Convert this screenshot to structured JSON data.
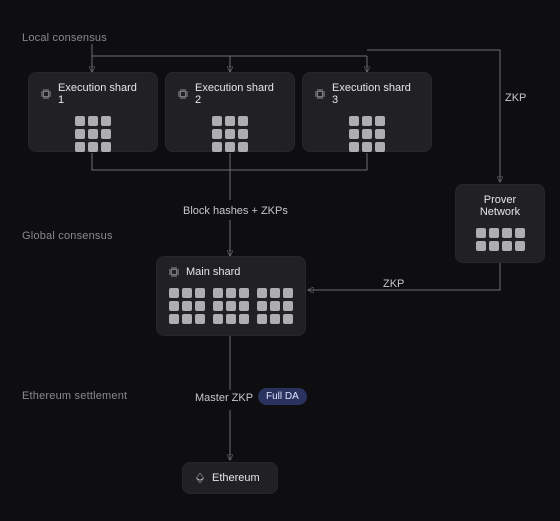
{
  "sections": {
    "local": "Local consensus",
    "global": "Global consensus",
    "settlement": "Ethereum settlement"
  },
  "shards": [
    {
      "label": "Execution shard 1"
    },
    {
      "label": "Execution shard 2"
    },
    {
      "label": "Execution shard 3"
    }
  ],
  "prover": {
    "label": "Prover Network"
  },
  "main_shard": {
    "label": "Main shard"
  },
  "ethereum": {
    "label": "Ethereum"
  },
  "edge_labels": {
    "zkp_top": "ZKP",
    "block_hashes": "Block hashes + ZKPs",
    "zkp_main": "ZKP",
    "master_zkp": "Master ZKP"
  },
  "pill": {
    "full_da": "Full DA"
  },
  "colors": {
    "bg": "#0e0e10",
    "card": "#212124",
    "cell": "#aeaeb2",
    "wire": "#6f6f74",
    "pill_bg": "#2a335f"
  }
}
